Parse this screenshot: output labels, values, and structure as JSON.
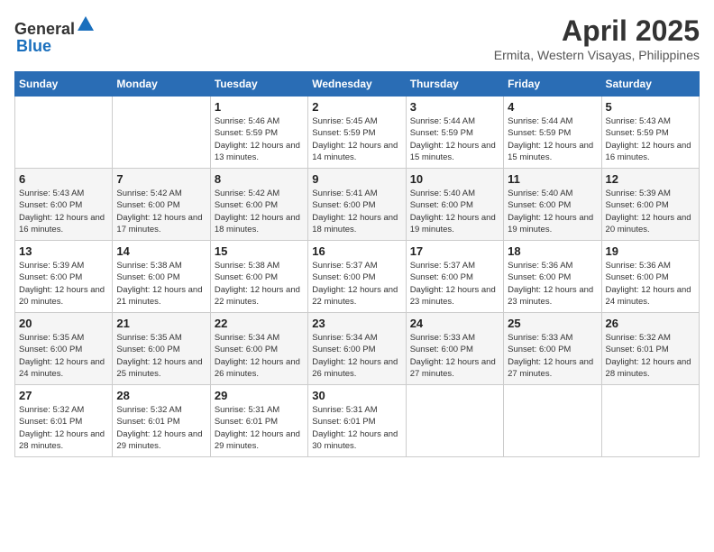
{
  "header": {
    "logo_general": "General",
    "logo_blue": "Blue",
    "month_year": "April 2025",
    "location": "Ermita, Western Visayas, Philippines"
  },
  "days_of_week": [
    "Sunday",
    "Monday",
    "Tuesday",
    "Wednesday",
    "Thursday",
    "Friday",
    "Saturday"
  ],
  "weeks": [
    [
      {
        "day": "",
        "sunrise": "",
        "sunset": "",
        "daylight": "",
        "empty": true
      },
      {
        "day": "",
        "sunrise": "",
        "sunset": "",
        "daylight": "",
        "empty": true
      },
      {
        "day": "1",
        "sunrise": "Sunrise: 5:46 AM",
        "sunset": "Sunset: 5:59 PM",
        "daylight": "Daylight: 12 hours and 13 minutes."
      },
      {
        "day": "2",
        "sunrise": "Sunrise: 5:45 AM",
        "sunset": "Sunset: 5:59 PM",
        "daylight": "Daylight: 12 hours and 14 minutes."
      },
      {
        "day": "3",
        "sunrise": "Sunrise: 5:44 AM",
        "sunset": "Sunset: 5:59 PM",
        "daylight": "Daylight: 12 hours and 15 minutes."
      },
      {
        "day": "4",
        "sunrise": "Sunrise: 5:44 AM",
        "sunset": "Sunset: 5:59 PM",
        "daylight": "Daylight: 12 hours and 15 minutes."
      },
      {
        "day": "5",
        "sunrise": "Sunrise: 5:43 AM",
        "sunset": "Sunset: 5:59 PM",
        "daylight": "Daylight: 12 hours and 16 minutes."
      }
    ],
    [
      {
        "day": "6",
        "sunrise": "Sunrise: 5:43 AM",
        "sunset": "Sunset: 6:00 PM",
        "daylight": "Daylight: 12 hours and 16 minutes."
      },
      {
        "day": "7",
        "sunrise": "Sunrise: 5:42 AM",
        "sunset": "Sunset: 6:00 PM",
        "daylight": "Daylight: 12 hours and 17 minutes."
      },
      {
        "day": "8",
        "sunrise": "Sunrise: 5:42 AM",
        "sunset": "Sunset: 6:00 PM",
        "daylight": "Daylight: 12 hours and 18 minutes."
      },
      {
        "day": "9",
        "sunrise": "Sunrise: 5:41 AM",
        "sunset": "Sunset: 6:00 PM",
        "daylight": "Daylight: 12 hours and 18 minutes."
      },
      {
        "day": "10",
        "sunrise": "Sunrise: 5:40 AM",
        "sunset": "Sunset: 6:00 PM",
        "daylight": "Daylight: 12 hours and 19 minutes."
      },
      {
        "day": "11",
        "sunrise": "Sunrise: 5:40 AM",
        "sunset": "Sunset: 6:00 PM",
        "daylight": "Daylight: 12 hours and 19 minutes."
      },
      {
        "day": "12",
        "sunrise": "Sunrise: 5:39 AM",
        "sunset": "Sunset: 6:00 PM",
        "daylight": "Daylight: 12 hours and 20 minutes."
      }
    ],
    [
      {
        "day": "13",
        "sunrise": "Sunrise: 5:39 AM",
        "sunset": "Sunset: 6:00 PM",
        "daylight": "Daylight: 12 hours and 20 minutes."
      },
      {
        "day": "14",
        "sunrise": "Sunrise: 5:38 AM",
        "sunset": "Sunset: 6:00 PM",
        "daylight": "Daylight: 12 hours and 21 minutes."
      },
      {
        "day": "15",
        "sunrise": "Sunrise: 5:38 AM",
        "sunset": "Sunset: 6:00 PM",
        "daylight": "Daylight: 12 hours and 22 minutes."
      },
      {
        "day": "16",
        "sunrise": "Sunrise: 5:37 AM",
        "sunset": "Sunset: 6:00 PM",
        "daylight": "Daylight: 12 hours and 22 minutes."
      },
      {
        "day": "17",
        "sunrise": "Sunrise: 5:37 AM",
        "sunset": "Sunset: 6:00 PM",
        "daylight": "Daylight: 12 hours and 23 minutes."
      },
      {
        "day": "18",
        "sunrise": "Sunrise: 5:36 AM",
        "sunset": "Sunset: 6:00 PM",
        "daylight": "Daylight: 12 hours and 23 minutes."
      },
      {
        "day": "19",
        "sunrise": "Sunrise: 5:36 AM",
        "sunset": "Sunset: 6:00 PM",
        "daylight": "Daylight: 12 hours and 24 minutes."
      }
    ],
    [
      {
        "day": "20",
        "sunrise": "Sunrise: 5:35 AM",
        "sunset": "Sunset: 6:00 PM",
        "daylight": "Daylight: 12 hours and 24 minutes."
      },
      {
        "day": "21",
        "sunrise": "Sunrise: 5:35 AM",
        "sunset": "Sunset: 6:00 PM",
        "daylight": "Daylight: 12 hours and 25 minutes."
      },
      {
        "day": "22",
        "sunrise": "Sunrise: 5:34 AM",
        "sunset": "Sunset: 6:00 PM",
        "daylight": "Daylight: 12 hours and 26 minutes."
      },
      {
        "day": "23",
        "sunrise": "Sunrise: 5:34 AM",
        "sunset": "Sunset: 6:00 PM",
        "daylight": "Daylight: 12 hours and 26 minutes."
      },
      {
        "day": "24",
        "sunrise": "Sunrise: 5:33 AM",
        "sunset": "Sunset: 6:00 PM",
        "daylight": "Daylight: 12 hours and 27 minutes."
      },
      {
        "day": "25",
        "sunrise": "Sunrise: 5:33 AM",
        "sunset": "Sunset: 6:00 PM",
        "daylight": "Daylight: 12 hours and 27 minutes."
      },
      {
        "day": "26",
        "sunrise": "Sunrise: 5:32 AM",
        "sunset": "Sunset: 6:01 PM",
        "daylight": "Daylight: 12 hours and 28 minutes."
      }
    ],
    [
      {
        "day": "27",
        "sunrise": "Sunrise: 5:32 AM",
        "sunset": "Sunset: 6:01 PM",
        "daylight": "Daylight: 12 hours and 28 minutes."
      },
      {
        "day": "28",
        "sunrise": "Sunrise: 5:32 AM",
        "sunset": "Sunset: 6:01 PM",
        "daylight": "Daylight: 12 hours and 29 minutes."
      },
      {
        "day": "29",
        "sunrise": "Sunrise: 5:31 AM",
        "sunset": "Sunset: 6:01 PM",
        "daylight": "Daylight: 12 hours and 29 minutes."
      },
      {
        "day": "30",
        "sunrise": "Sunrise: 5:31 AM",
        "sunset": "Sunset: 6:01 PM",
        "daylight": "Daylight: 12 hours and 30 minutes."
      },
      {
        "day": "",
        "sunrise": "",
        "sunset": "",
        "daylight": "",
        "empty": true
      },
      {
        "day": "",
        "sunrise": "",
        "sunset": "",
        "daylight": "",
        "empty": true
      },
      {
        "day": "",
        "sunrise": "",
        "sunset": "",
        "daylight": "",
        "empty": true
      }
    ]
  ]
}
